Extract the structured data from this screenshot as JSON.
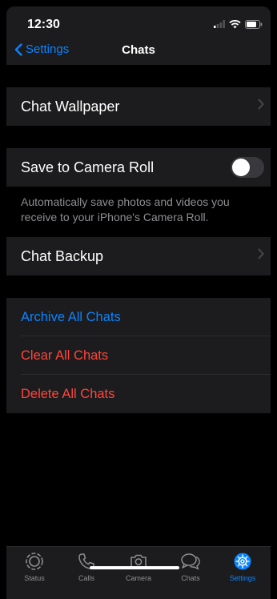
{
  "status_bar": {
    "time": "12:30"
  },
  "nav": {
    "back_label": "Settings",
    "title": "Chats"
  },
  "sections": {
    "wallpaper": {
      "label": "Chat Wallpaper"
    },
    "camera_roll": {
      "label": "Save to Camera Roll",
      "toggle_on": false,
      "footer": "Automatically save photos and videos you receive to your iPhone's Camera Roll."
    },
    "backup": {
      "label": "Chat Backup"
    },
    "actions": {
      "archive": "Archive All Chats",
      "clear": "Clear All Chats",
      "delete": "Delete All Chats"
    }
  },
  "tabbar": {
    "tabs": [
      {
        "label": "Status",
        "icon": "status-icon"
      },
      {
        "label": "Calls",
        "icon": "phone-icon"
      },
      {
        "label": "Camera",
        "icon": "camera-icon"
      },
      {
        "label": "Chats",
        "icon": "chat-bubbles-icon"
      },
      {
        "label": "Settings",
        "icon": "gear-icon",
        "active": true
      }
    ]
  },
  "colors": {
    "accent": "#0a84ff",
    "destructive": "#ff453a",
    "cell_bg": "#1c1c1e",
    "secondary_text": "#8e8e93"
  }
}
